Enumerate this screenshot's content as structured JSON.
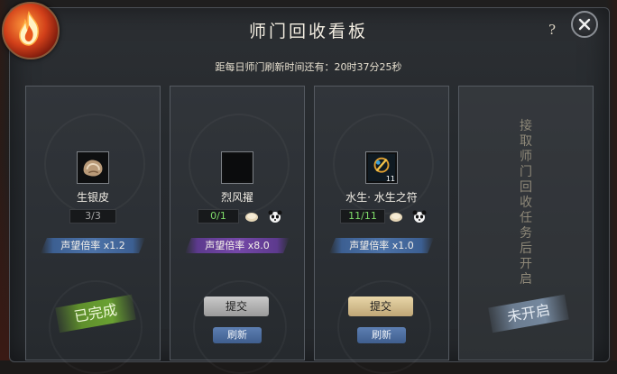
{
  "window": {
    "title": "师门回收看板",
    "help_label": "?",
    "timer_text": "距每日师门刷新时间还有：20时37分25秒"
  },
  "cards": [
    {
      "item_name": "生银皮",
      "progress": "3/3",
      "rate": "声望倍率 x1.2",
      "rate_style": "blue",
      "status": "已完成"
    },
    {
      "item_name": "烈风擢",
      "progress": "0/1",
      "rate": "声望倍率 x8.0",
      "rate_style": "purple",
      "submit_label": "提交",
      "refresh_label": "刷新"
    },
    {
      "item_name": "水生· 水生之符",
      "item_count": "11",
      "progress": "11/11",
      "rate": "声望倍率 x1.0",
      "rate_style": "blue",
      "submit_label": "提交",
      "refresh_label": "刷新"
    },
    {
      "locked_text": [
        "接",
        "取",
        "师",
        "门",
        "回",
        "收",
        "任",
        "务",
        "后",
        "开",
        "启"
      ],
      "status": "未开启"
    }
  ],
  "colors": {
    "progress_done": "#a6a6a6",
    "progress_active": "#7fdc6a",
    "rate_blue": "#4d73a8",
    "rate_purple": "#7548a8",
    "stamp_done": "#6aa132",
    "stamp_closed": "#75889e"
  },
  "icons": [
    "flame-logo-icon",
    "close-icon",
    "silver-hide-icon",
    "bun-icon",
    "panda-icon",
    "talisman-icon"
  ]
}
